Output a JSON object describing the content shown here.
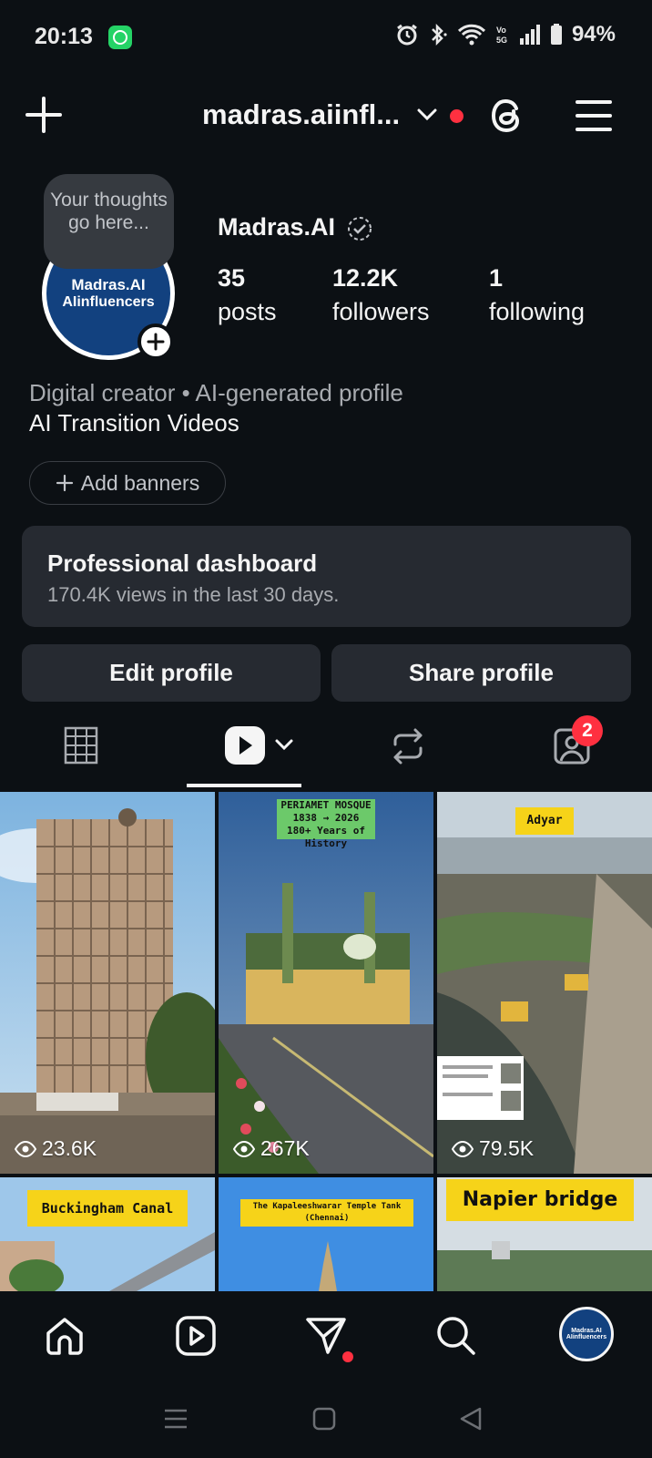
{
  "status": {
    "time": "20:13",
    "battery": "94%",
    "icons": [
      "whatsapp-icon",
      "alarm-icon",
      "bluetooth-icon",
      "wifi-icon",
      "volte-icon",
      "signal-icon",
      "battery-icon"
    ]
  },
  "header": {
    "username": "madras.aiinfl...",
    "icons": [
      "plus-icon",
      "chevron-down-icon",
      "threads-icon",
      "menu-icon"
    ]
  },
  "profile": {
    "thought_bubble": "Your thoughts go here...",
    "avatar_line1": "Madras.AI",
    "avatar_line2": "AIinfluencers",
    "display_name": "Madras.AI",
    "stats": [
      {
        "value": "35",
        "label": "posts"
      },
      {
        "value": "12.2K",
        "label": "followers"
      },
      {
        "value": "1",
        "label": "following"
      }
    ],
    "category": "Digital creator • AI-generated profile",
    "bio": "AI Transition Videos",
    "add_banners": "Add banners"
  },
  "dashboard": {
    "title": "Professional dashboard",
    "subtitle": "170.4K views in the last 30 days."
  },
  "buttons": {
    "edit": "Edit profile",
    "share": "Share profile"
  },
  "tabs": {
    "items": [
      "grid-tab",
      "reels-tab",
      "reposts-tab",
      "tagged-tab"
    ],
    "tagged_badge": "2"
  },
  "posts": [
    {
      "views": "23.6K"
    },
    {
      "views": "267K",
      "label": "PERIAMET MOSQUE\n1838 → 2026\n180+ Years of History"
    },
    {
      "views": "79.5K",
      "label": "Adyar"
    },
    {
      "label": "Buckingham Canal"
    },
    {
      "label": "The Kapaleeshwarar Temple Tank (Chennai)"
    },
    {
      "label": "Napier bridge"
    }
  ],
  "colors": {
    "background": "#0c1014",
    "surface": "#262a31",
    "accent_red": "#ff3040",
    "text_primary": "#f5f5f5",
    "text_secondary": "#a8abb0"
  }
}
